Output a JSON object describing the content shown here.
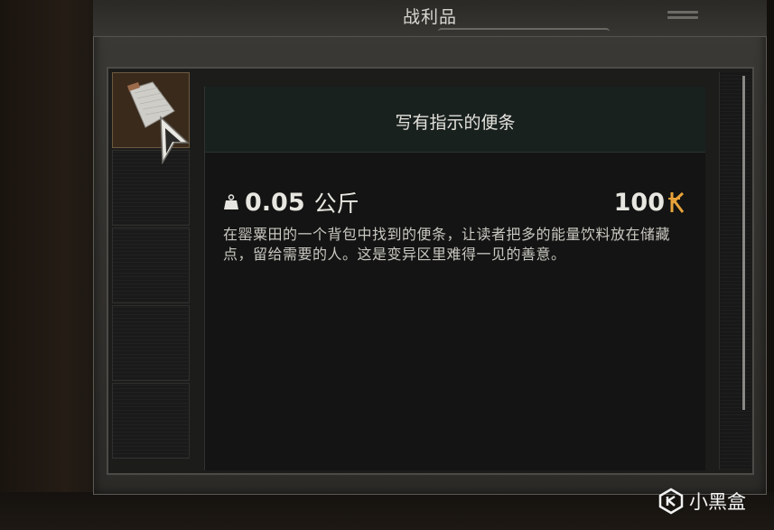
{
  "window": {
    "title": "战利品"
  },
  "item": {
    "name": "写有指示的便条",
    "weight_value": "0.05",
    "weight_unit": "公斤",
    "price": "100",
    "description": "在罂粟田的一个背包中找到的便条，让读者把多的能量饮料放在储藏点，留给需要的人。这是变异区里难得一见的善意。"
  },
  "inventory": {
    "slots": 5,
    "selected_index": 0
  },
  "icons": {
    "weight": "weight-bag-icon",
    "currency": "currency-k-icon",
    "menu": "hamburger-menu-icon",
    "cursor": "pointer-cursor-icon"
  },
  "colors": {
    "currency": "#e8a33a"
  },
  "watermark": {
    "text": "小黑盒"
  }
}
